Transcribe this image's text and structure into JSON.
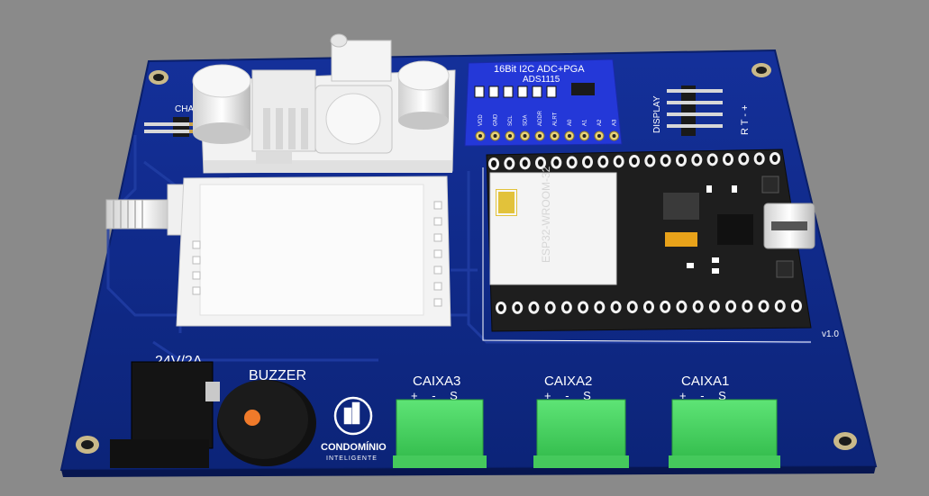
{
  "board": {
    "version": "v1.0",
    "colors": {
      "background": "#8a8a8a",
      "pcb": "#0f2a86",
      "pcb_trace": "#1c3a9e",
      "silkscreen": "#ffffff",
      "terminal_green": "#3fd35a",
      "ads_module": "#2438d8",
      "esp_board": "#1e1e1e"
    }
  },
  "labels": {
    "chave": "CHAVE",
    "display": "DISPLAY",
    "display_pins": "R T - +",
    "power": "24V/2A",
    "buzzer": "BUZZER",
    "caixa3": "CAIXA3",
    "caixa2": "CAIXA2",
    "caixa1": "CAIXA1",
    "terminal_pins_3": "+ - S",
    "terminal_pins_2": "+ - S",
    "terminal_pins_1": "+ - S"
  },
  "ads1115": {
    "line1": "16Bit  I2C  ADC+PGA",
    "line2": "ADS1115",
    "pins": [
      "VDD",
      "GND",
      "SCL",
      "SDA",
      "ADDR",
      "ALRT",
      "A0",
      "A1",
      "A2",
      "A3"
    ]
  },
  "esp32": {
    "module_text": "ESP32-WROOM-32"
  },
  "logo": {
    "name": "CONDOMÍNIO",
    "tagline": "INTELIGENTE",
    "icon": "building-house-icon"
  }
}
